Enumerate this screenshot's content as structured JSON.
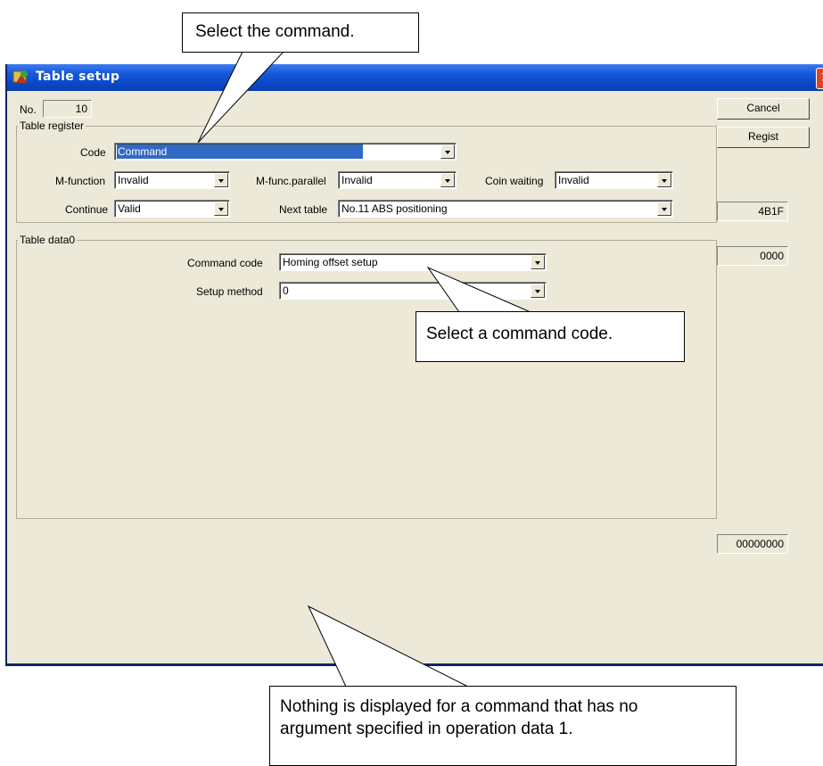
{
  "callouts": {
    "top": "Select the command.",
    "middle": "Select a command code.",
    "bottom_line1": "Nothing is displayed for a command that has no",
    "bottom_line2": "argument specified in operation data 1."
  },
  "window": {
    "title": "Table setup",
    "close": "✕",
    "no_label": "No.",
    "no_value": "10"
  },
  "table_register": {
    "title": "Table register",
    "code_label": "Code",
    "code_value": "Command",
    "mfunction_label": "M-function",
    "mfunction_value": "Invalid",
    "mfunc_parallel_label": "M-func.parallel",
    "mfunc_parallel_value": "Invalid",
    "coin_waiting_label": "Coin waiting",
    "coin_waiting_value": "Invalid",
    "continue_label": "Continue",
    "continue_value": "Valid",
    "next_table_label": "Next table",
    "next_table_value": "No.11 ABS positioning"
  },
  "table_data0": {
    "title": "Table data0",
    "command_code_label": "Command code",
    "command_code_value": "Homing offset setup",
    "setup_method_label": "Setup method",
    "setup_method_value": "0"
  },
  "side": {
    "cancel_label": "Cancel",
    "regist_label": "Regist",
    "hex_register": "4B1F",
    "hex_data0": "0000",
    "hex_data1": "00000000"
  },
  "icons": {
    "title_icon": "app-icon",
    "combo_arrow": "chevron-down-icon"
  }
}
